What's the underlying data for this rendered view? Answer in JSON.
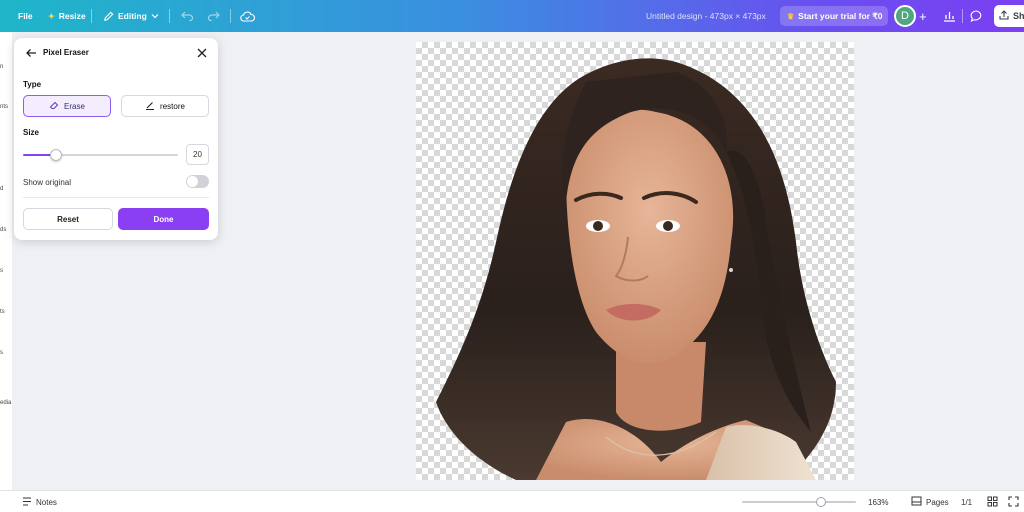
{
  "topbar": {
    "file": "File",
    "resize": "Resize",
    "editing": "Editing",
    "title": "Untitled design - 473px × 473px",
    "trial": "Start your trial for ₹0",
    "avatar_letter": "D",
    "share": "Sh"
  },
  "rail": {
    "labels": [
      "n",
      "nts",
      "d",
      "ds",
      "s",
      "ts",
      "s",
      "edia"
    ]
  },
  "panel": {
    "title": "Pixel Eraser",
    "type_label": "Type",
    "erase": "Erase",
    "restore": "restore",
    "size_label": "Size",
    "size_value": "20",
    "size_fraction": 0.21,
    "show_original": "Show original",
    "show_original_on": false,
    "reset": "Reset",
    "done": "Done"
  },
  "bottombar": {
    "notes": "Notes",
    "zoom": "163%",
    "pages": "Pages",
    "page_count": "1/1"
  },
  "colors": {
    "accent": "#8b3ff2",
    "topbar_start": "#1fb6c9",
    "topbar_end": "#7b3ff2"
  }
}
